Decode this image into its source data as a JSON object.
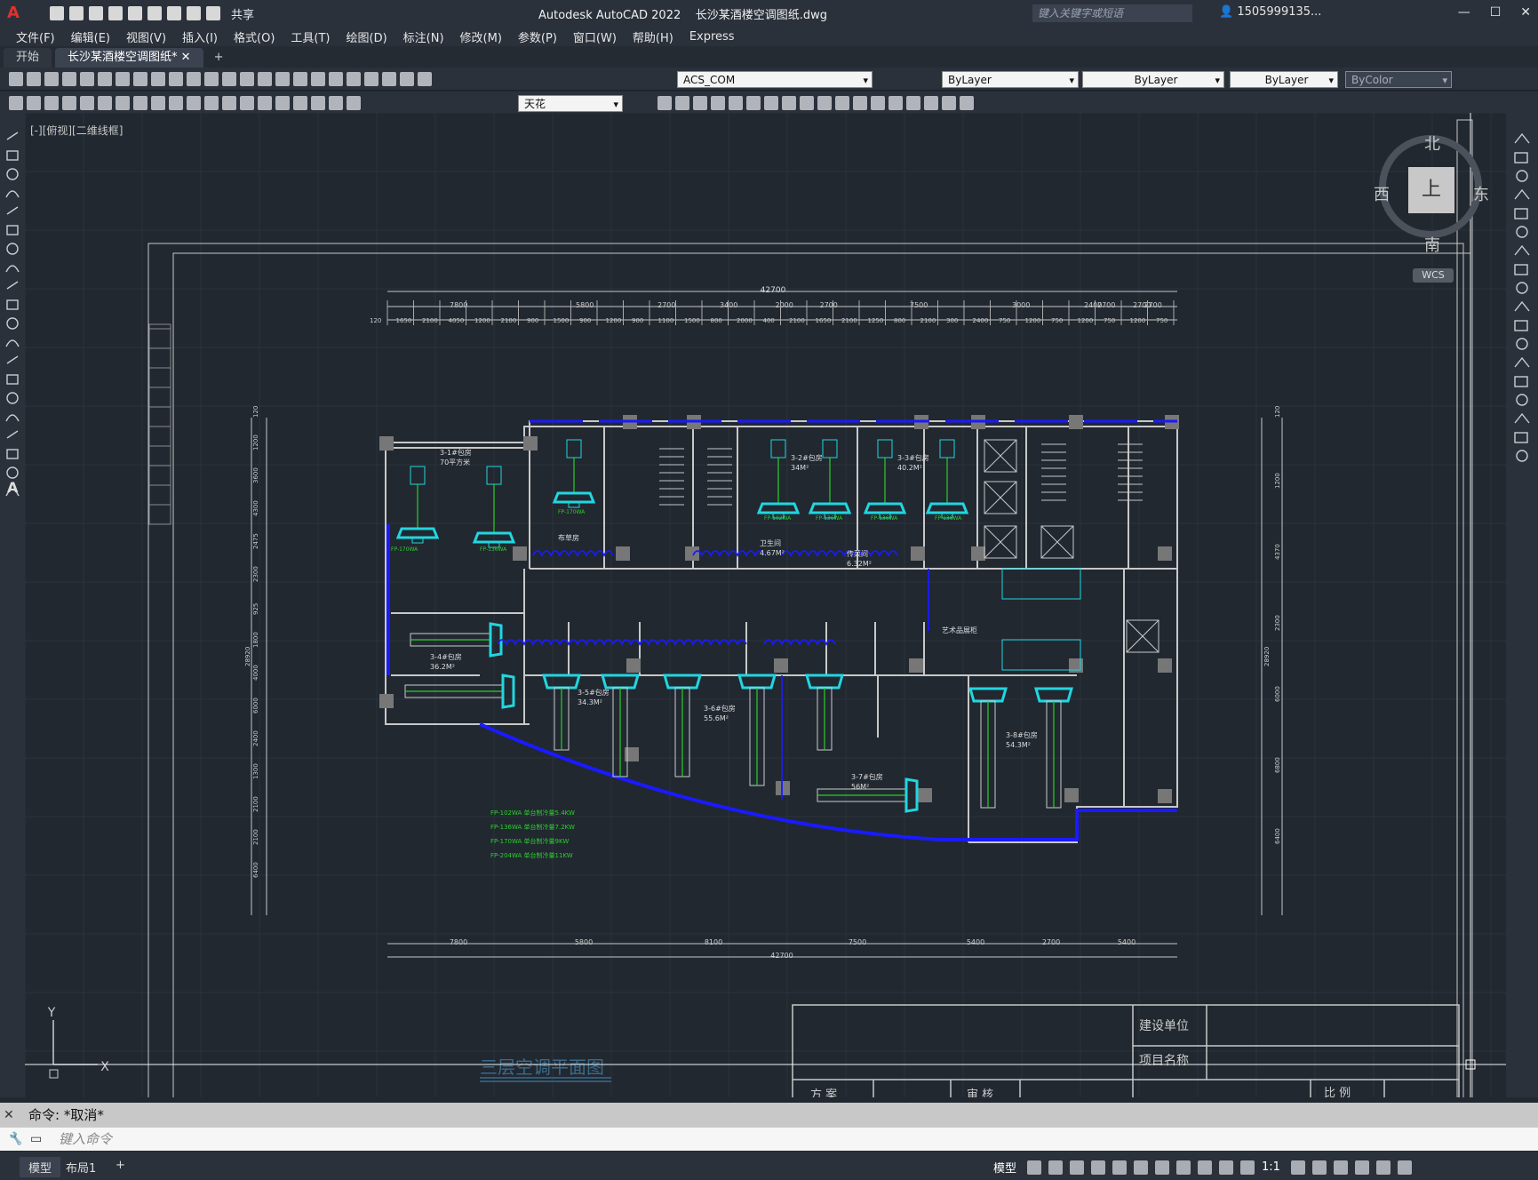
{
  "app": {
    "title": "Autodesk AutoCAD 2022",
    "file": "长沙某酒楼空调图纸.dwg",
    "search_placeholder": "键入关键字或短语",
    "user": "1505999135...",
    "share": "共享"
  },
  "menu": [
    "文件(F)",
    "编辑(E)",
    "视图(V)",
    "插入(I)",
    "格式(O)",
    "工具(T)",
    "绘图(D)",
    "标注(N)",
    "修改(M)",
    "参数(P)",
    "窗口(W)",
    "帮助(H)",
    "Express"
  ],
  "tabs": [
    {
      "label": "开始",
      "active": false
    },
    {
      "label": "长沙某酒楼空调图纸*",
      "active": true
    }
  ],
  "toolbar": {
    "layer": "ACS_COM",
    "color": "ByLayer",
    "linetype": "ByLayer",
    "lineweight": "ByLayer",
    "plotstyle": "ByColor",
    "textstyle": "天花"
  },
  "viewport": {
    "label": "[-][俯视][二维线框]",
    "compass": {
      "north": "北",
      "south": "南",
      "east": "东",
      "west": "西",
      "top": "上"
    },
    "wcs": "WCS"
  },
  "drawing": {
    "title": "三层空调平面图",
    "total_dim": "42700",
    "top_dims": [
      "7800",
      "5800",
      "2700",
      "3400",
      "2000",
      "2700",
      "7500",
      "3000",
      "2400",
      "2700",
      "2700",
      "2700"
    ],
    "sub_dims": [
      "120",
      "1650",
      "2100",
      "4050",
      "1200",
      "2100",
      "900",
      "1500",
      "900",
      "1200",
      "900",
      "1100",
      "1500",
      "800",
      "2000",
      "400",
      "2100",
      "1650",
      "2100",
      "1250",
      "800",
      "2100",
      "300",
      "2400",
      "750",
      "1200",
      "750",
      "1200",
      "750",
      "1200",
      "750"
    ],
    "bottom_dims": [
      "7800",
      "5800",
      "8100",
      "7500",
      "5400",
      "2700",
      "5400"
    ],
    "left_dims": [
      "120",
      "1200",
      "3600",
      "4300",
      "2475",
      "2300",
      "925",
      "1800",
      "4000",
      "6000",
      "2400",
      "1300",
      "2100",
      "2100",
      "6400"
    ],
    "side_total": "28920",
    "right_dims": [
      "120",
      "1200",
      "4370",
      "2300",
      "6000",
      "6800",
      "6400"
    ],
    "rooms": [
      {
        "name": "3-1#包房",
        "sub": "70平方米"
      },
      {
        "name": "3-2#包房",
        "sub": "34M²"
      },
      {
        "name": "3-3#包房",
        "sub": "40.2M²"
      },
      {
        "name": "3-4#包房",
        "sub": "36.2M²"
      },
      {
        "name": "3-5#包房",
        "sub": "34.3M²"
      },
      {
        "name": "3-6#包房",
        "sub": "55.6M²"
      },
      {
        "name": "3-7#包房",
        "sub": "56M²"
      },
      {
        "name": "3-8#包房",
        "sub": "54.3M²"
      },
      {
        "name": "布草房",
        "sub": ""
      },
      {
        "name": "卫生间",
        "sub": "4.67M²"
      },
      {
        "name": "传菜间",
        "sub": "6.32M²"
      },
      {
        "name": "艺术品展柜",
        "sub": ""
      }
    ],
    "legend": [
      "FP-102WA    单台制冷量5.4KW",
      "FP-136WA    单台制冷量7.2KW",
      "FP-170WA    单台制冷量9KW",
      "FP-204WA    单台制冷量11KW"
    ],
    "titleblock": {
      "unit": "建设单位",
      "project": "项目名称",
      "scheme": "方 案",
      "review": "审 核",
      "scale": "比 例"
    }
  },
  "command": {
    "last": "命令: *取消*",
    "placeholder": "键入命令"
  },
  "status": {
    "model": "模型",
    "layout": "布局1",
    "scale": "1:1",
    "mode": "模型"
  },
  "colors": {
    "wall": "#c8c8c8",
    "pipe_blue": "#1a1aff",
    "duct_cyan": "#21d6e0",
    "label_green": "#2bd02b",
    "background": "#212830",
    "grid": "#2a323c"
  }
}
